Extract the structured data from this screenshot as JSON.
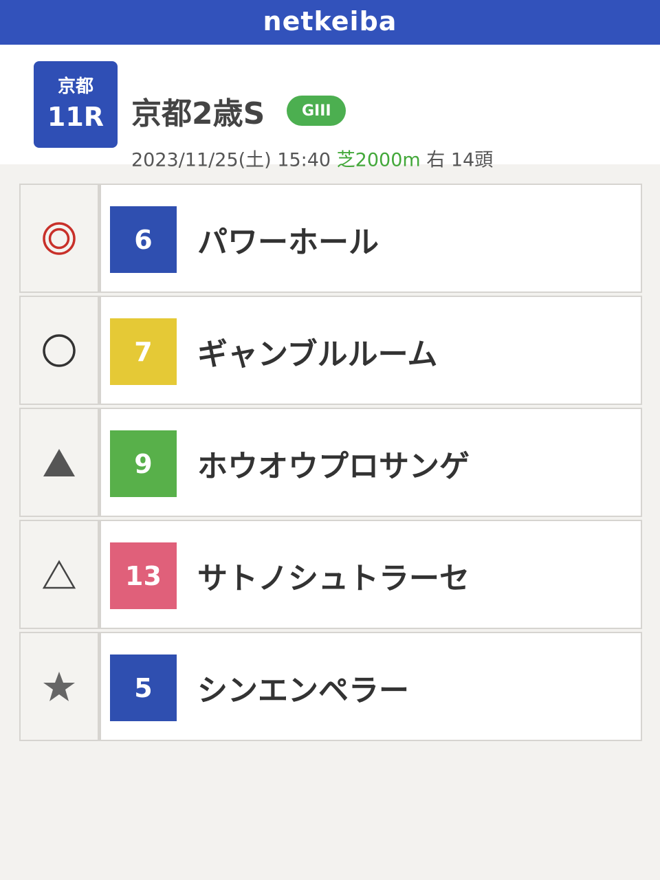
{
  "app": {
    "logo": "netkeiba",
    "header_color": "#3252bb"
  },
  "race": {
    "venue": "京都",
    "number": "11R",
    "name": "京都2歳S",
    "grade": "GIII",
    "datetime": "2023/11/25(土) 15:40",
    "course": "芝2000m",
    "direction_heads": "右 14頭"
  },
  "picks": [
    {
      "mark": "double-circle",
      "number": "6",
      "number_color": "#2f4fb0",
      "name": "パワーホール"
    },
    {
      "mark": "circle",
      "number": "7",
      "number_color": "#e5c936",
      "name": "ギャンブルルーム"
    },
    {
      "mark": "filled-triangle",
      "number": "9",
      "number_color": "#58b04a",
      "name": "ホウオウプロサンゲ"
    },
    {
      "mark": "open-triangle",
      "number": "13",
      "number_color": "#e0607a",
      "name": "サトノシュトラーセ"
    },
    {
      "mark": "star",
      "number": "5",
      "number_color": "#2f4fb0",
      "name": "シンエンペラー"
    }
  ]
}
